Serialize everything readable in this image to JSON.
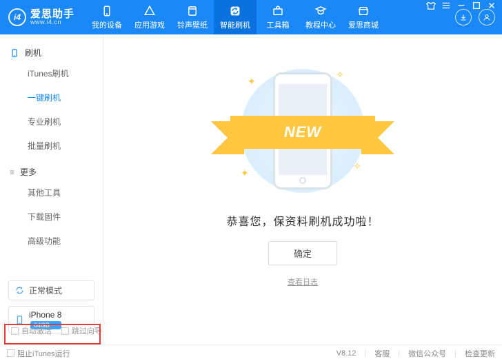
{
  "logo": {
    "glyph": "i4",
    "title": "爱思助手",
    "subtitle": "www.i4.cn"
  },
  "nav": [
    {
      "label": "我的设备"
    },
    {
      "label": "应用游戏"
    },
    {
      "label": "铃声壁纸"
    },
    {
      "label": "智能刷机"
    },
    {
      "label": "工具箱"
    },
    {
      "label": "教程中心"
    },
    {
      "label": "爱思商城"
    }
  ],
  "sidebar": {
    "flash": {
      "title": "刷机",
      "items": [
        "iTunes刷机",
        "一键刷机",
        "专业刷机",
        "批量刷机"
      ]
    },
    "more": {
      "title": "更多",
      "items": [
        "其他工具",
        "下载固件",
        "高级功能"
      ]
    },
    "mode": {
      "label": "正常模式"
    },
    "device": {
      "name": "iPhone 8",
      "storage": "64GB"
    }
  },
  "content": {
    "ribbon": "NEW",
    "message": "恭喜您，保资料刷机成功啦！",
    "ok": "确定",
    "log": "查看日志"
  },
  "bottomChecks": {
    "auto_activate": "自动激活",
    "skip_guide": "跳过向导"
  },
  "status": {
    "block_itunes": "阻止iTunes运行",
    "version": "V8.12",
    "right": [
      "客服",
      "微信公众号",
      "检查更新"
    ]
  }
}
